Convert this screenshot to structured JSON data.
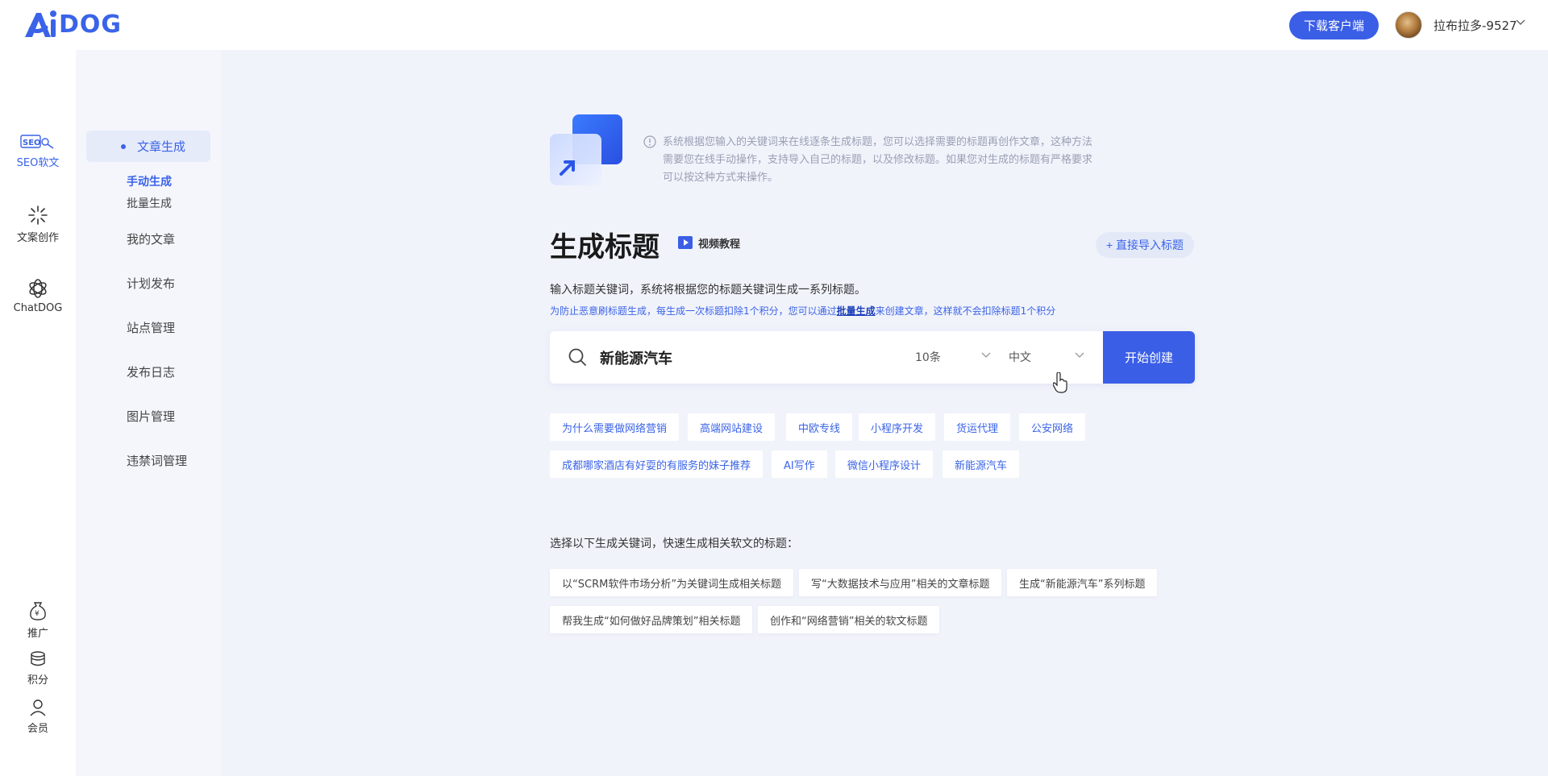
{
  "header": {
    "logo_text": "DOG",
    "logo_prefix": "Ai",
    "download_label": "下载客户端",
    "username": "拉布拉多-9527"
  },
  "rail": {
    "items": [
      {
        "label": "SEO软文",
        "icon": "seo-icon",
        "active": true
      },
      {
        "label": "文案创作",
        "icon": "sparkle-icon"
      },
      {
        "label": "ChatDOG",
        "icon": "chat-knot-icon"
      },
      {
        "label": "推广",
        "icon": "money-bag-icon"
      },
      {
        "label": "积分",
        "icon": "coins-icon"
      },
      {
        "label": "会员",
        "icon": "user-icon"
      }
    ],
    "seo_badge": "SEO"
  },
  "subnav": {
    "active_group": "文章生成",
    "sub_items": [
      "手动生成",
      "批量生成"
    ],
    "items": [
      "我的文章",
      "计划发布",
      "站点管理",
      "发布日志",
      "图片管理",
      "违禁词管理"
    ]
  },
  "main": {
    "notice": "系统根据您输入的关键词来在线逐条生成标题，您可以选择需要的标题再创作文章，这种方法需要您在线手动操作，支持导入自己的标题，以及修改标题。如果您对生成的标题有严格要求可以按这种方式来操作。",
    "title": "生成标题",
    "video_label": "视频教程",
    "import_label": "+ 直接导入标题",
    "desc": "输入标题关键词，系统将根据您的标题关键词生成一系列标题。",
    "warn_prefix": "为防止恶意刷标题生成，每生成一次标题扣除1个积分，您可以通过",
    "warn_link": "批量生成",
    "warn_suffix": "来创建文章，这样就不会扣除标题1个积分",
    "search_value": "新能源汽车",
    "count_option": "10条",
    "lang_option": "中文",
    "create_label": "开始创建",
    "history_chips_row1": [
      "为什么需要做网络营销",
      "高端网站建设",
      "中欧专线",
      "小程序开发",
      "货运代理",
      "公安网络"
    ],
    "history_chips_row2": [
      "成都哪家酒店有好耍的有服务的妹子推荐",
      "AI写作",
      "微信小程序设计",
      "新能源汽车"
    ],
    "suggest_label": "选择以下生成关键词，快速生成相关软文的标题：",
    "suggest_row1": [
      "以“SCRM软件市场分析”为关键词生成相关标题",
      "写“大数据技术与应用”相关的文章标题",
      "生成“新能源汽车”系列标题"
    ],
    "suggest_row2": [
      "帮我生成“如何做好品牌策划”相关标题",
      "创作和“网络营销”相关的软文标题"
    ]
  },
  "colors": {
    "accent": "#3a5ee6",
    "link": "#3a63e8",
    "main_bg": "#f1f3fb",
    "subnav_bg": "#f4f6fc"
  }
}
